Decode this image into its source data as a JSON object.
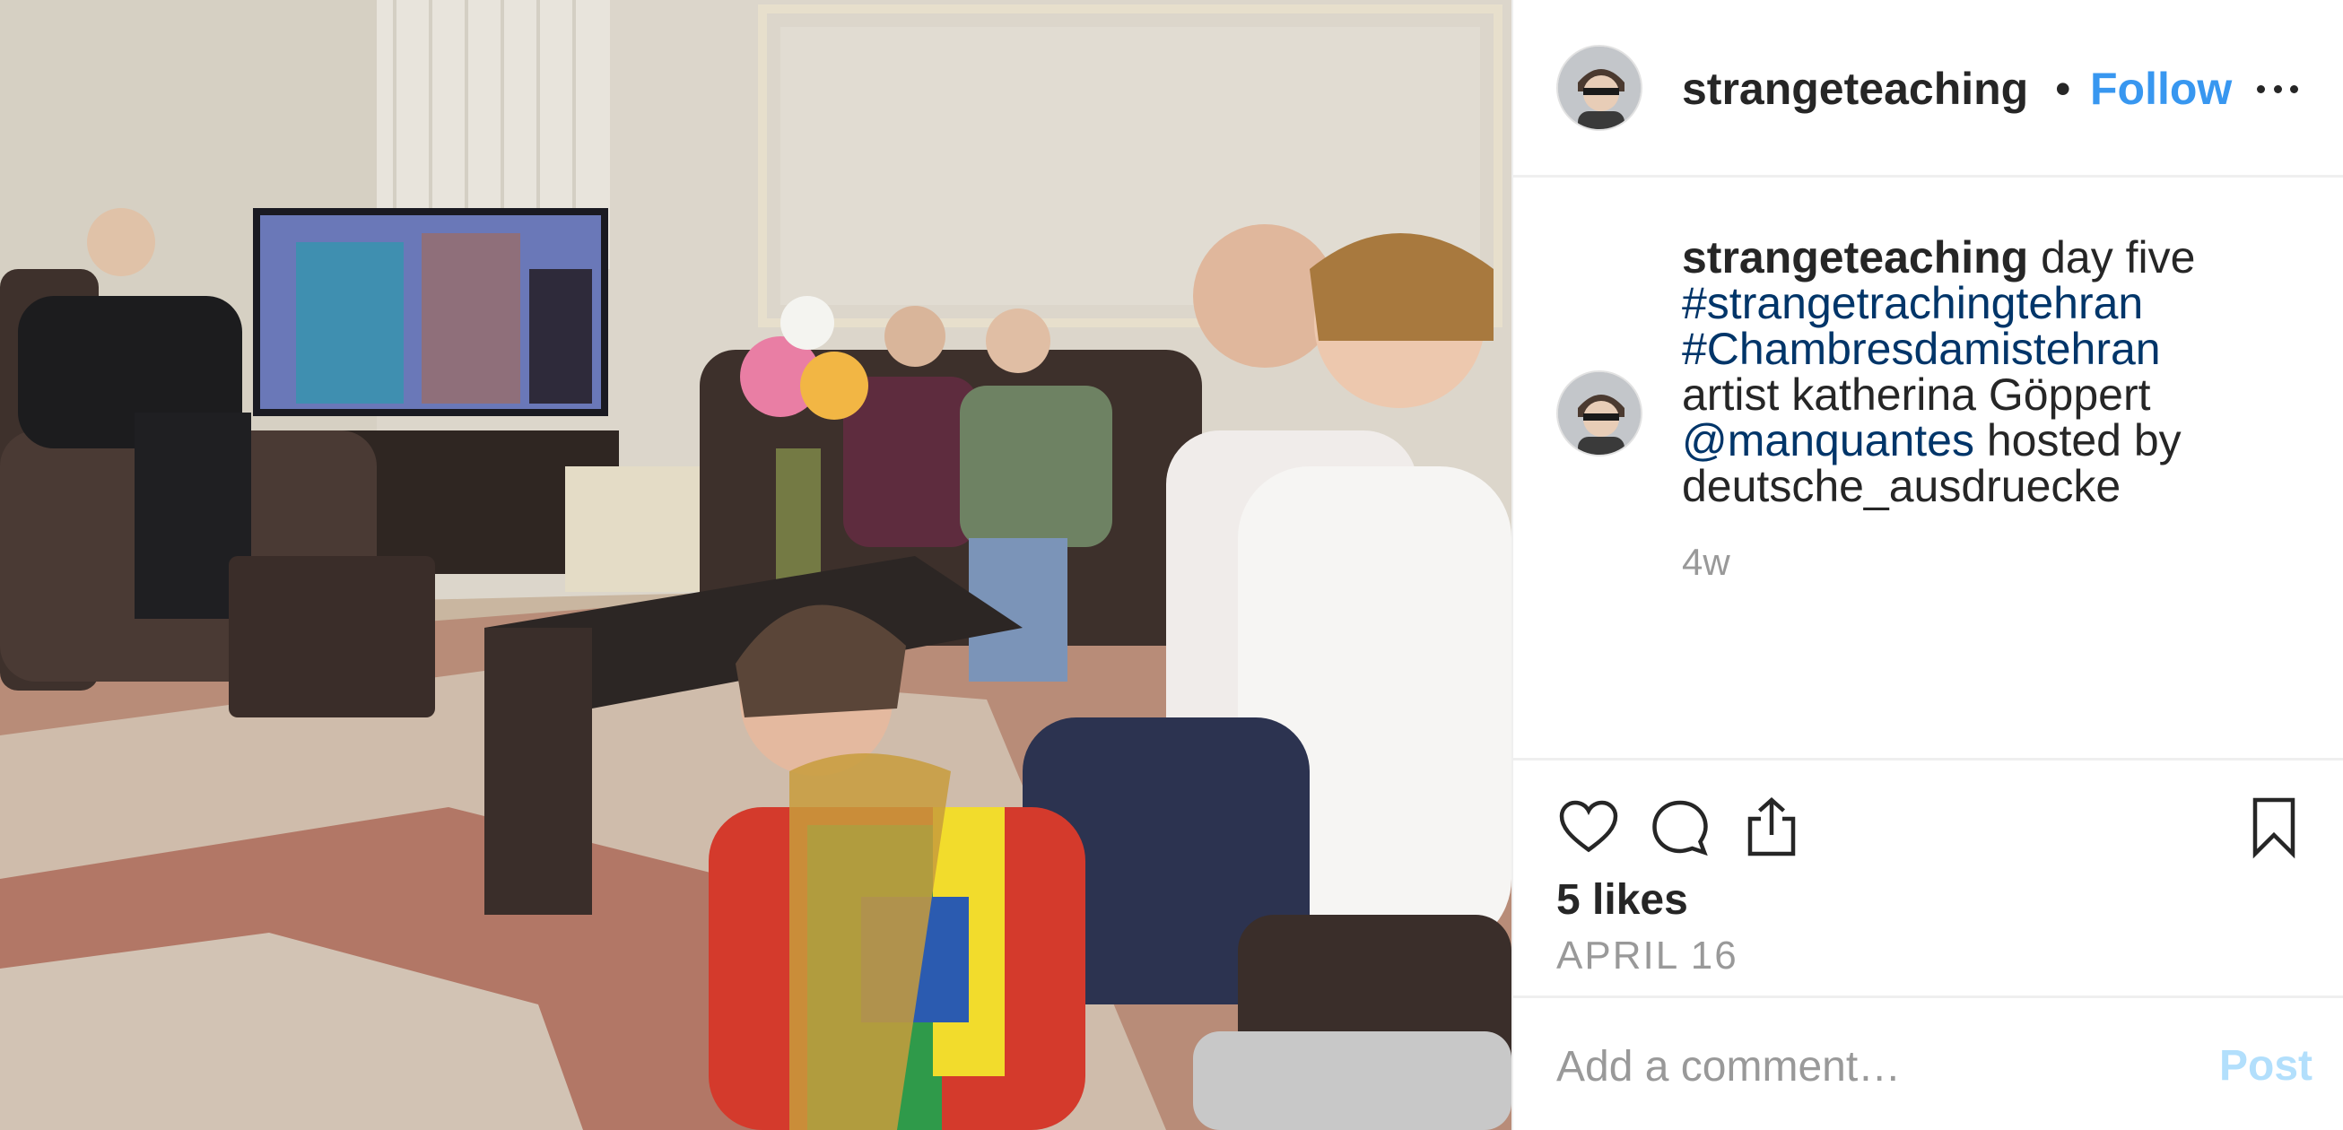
{
  "header": {
    "username": "strangeteaching",
    "separator": "•",
    "follow_label": "Follow",
    "more_icon": "more-horizontal-icon"
  },
  "caption": {
    "username": "strangeteaching",
    "text_first": " day five",
    "hashtag_1": "#strangetrachingtehran",
    "hashtag_2": "#Chambresdamistehran",
    "artist_line": "artist katherina Göppert",
    "mention": "@manquantes",
    "hosted_by": " hosted by",
    "host_line": "deutsche_ausdruecke",
    "time_ago": "4w"
  },
  "actions": {
    "like_icon": "heart-icon",
    "comment_icon": "comment-bubble-icon",
    "share_icon": "share-upload-icon",
    "save_icon": "bookmark-icon",
    "likes_text": "5 likes",
    "date_text": "APRIL 16"
  },
  "comment_box": {
    "placeholder": "Add a comment…",
    "post_label": "Post"
  },
  "colors": {
    "link_blue": "#3897f0",
    "hashtag_navy": "#003569",
    "muted_gray": "#999999",
    "post_disabled": "#b2dffc",
    "divider": "#efefef"
  }
}
